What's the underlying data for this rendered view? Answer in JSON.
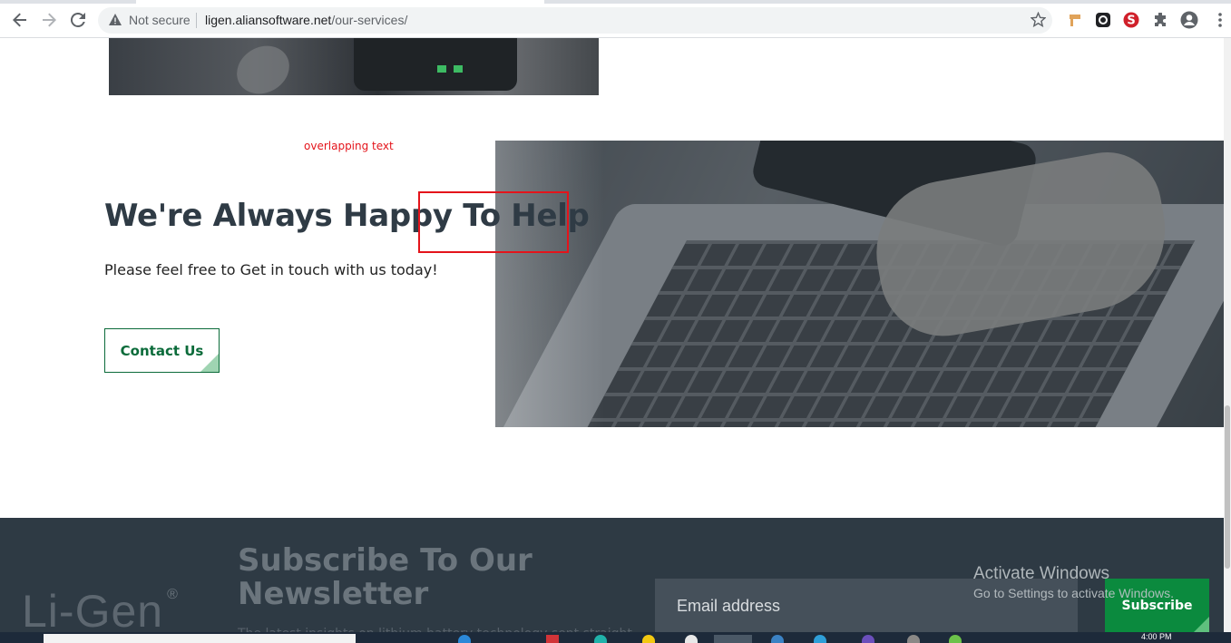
{
  "browser": {
    "security_label": "Not secure",
    "url_host": "ligen.aliansoftware.net",
    "url_path": "/our-services/"
  },
  "annotation": {
    "label": "overlapping text",
    "color": "#e4141b"
  },
  "cta": {
    "title": "We're Always Happy To Help",
    "subtitle": "Please feel free to Get in touch with us today!",
    "button_label": "Contact Us"
  },
  "footer": {
    "logo_text": "Li-Gen",
    "logo_mark": "®",
    "newsletter_title": "Subscribe To Our Newsletter",
    "newsletter_subtitle": "The latest insights on lithium battery technology sent straight",
    "email_placeholder": "Email address",
    "subscribe_label": "Subscribe"
  },
  "os_watermark": {
    "line1": "Activate Windows",
    "line2": "Go to Settings to activate Windows."
  },
  "taskbar": {
    "clock": "4:00 PM"
  },
  "colors": {
    "brand_green": "#0b6b3a",
    "footer_bg": "#2e3a44",
    "subscribe_green": "#0b8a3e"
  }
}
